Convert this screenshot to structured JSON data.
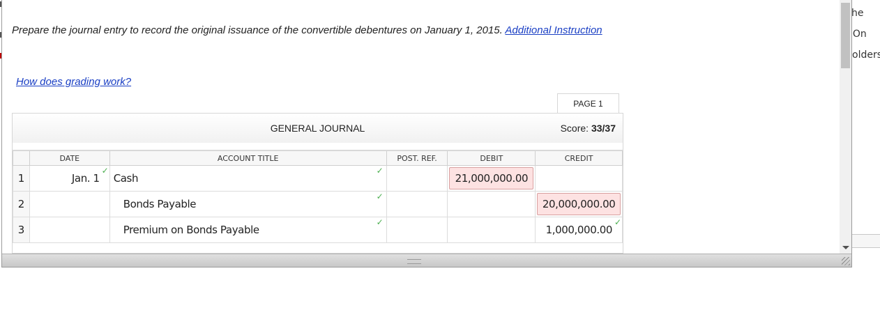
{
  "instruction": {
    "text": "Prepare the journal entry to record the original issuance of the convertible debentures on January 1, 2015. ",
    "link": "Additional Instruction"
  },
  "grading_link": "How does grading work?",
  "page_tab": "PAGE 1",
  "journal": {
    "title": "GENERAL JOURNAL",
    "score_label": "Score: ",
    "score_value": "33/37",
    "columns": {
      "date": "DATE",
      "account": "ACCOUNT TITLE",
      "post_ref": "POST. REF.",
      "debit": "DEBIT",
      "credit": "CREDIT"
    },
    "rows": [
      {
        "num": "1",
        "date": "Jan. 1",
        "account": "Cash",
        "post_ref": "",
        "debit": "21,000,000.00",
        "credit": ""
      },
      {
        "num": "2",
        "date": "",
        "account": "Bonds Payable",
        "post_ref": "",
        "debit": "",
        "credit": "20,000,000.00"
      },
      {
        "num": "3",
        "date": "",
        "account": "Premium on Bonds Payable",
        "post_ref": "",
        "debit": "",
        "credit": "1,000,000.00"
      }
    ],
    "check_mark": "✓"
  },
  "background_fragments": [
    "he",
    ". On",
    "olders"
  ],
  "colors": {
    "link": "#1a3fc4",
    "check": "#4caf50",
    "error_fill": "#fde2e2"
  }
}
